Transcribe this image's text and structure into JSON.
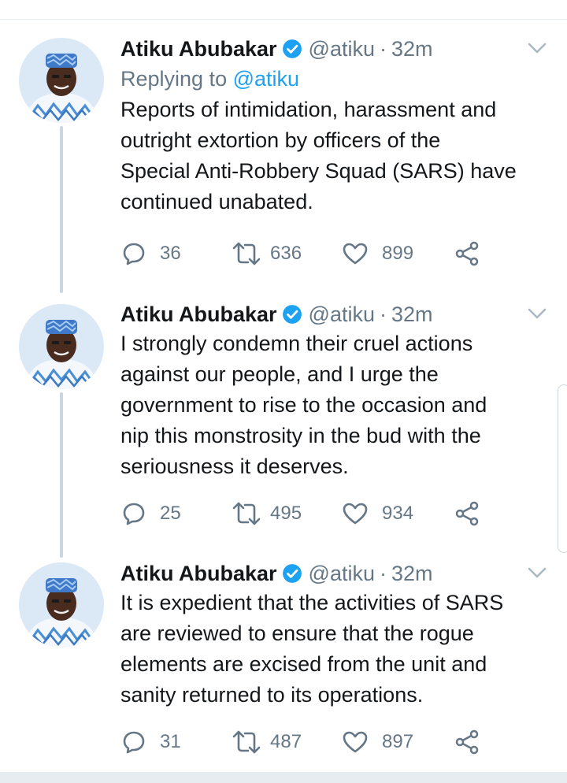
{
  "theme": {
    "accent": "#1da1f2",
    "secondary_text": "#657786",
    "thread_line": "#ccd6dd"
  },
  "tweets": [
    {
      "author_name": "Atiku Abubakar",
      "handle": "@atiku",
      "separator": "·",
      "time": "32m",
      "replying_prefix": "Replying to",
      "replying_mention": "@atiku",
      "text_lines": [
        "Reports of intimidation, harassment and",
        "outright extortion by officers of the",
        "Special Anti-Robbery Squad (SARS) have",
        "continued unabated."
      ],
      "replies": "36",
      "retweets": "636",
      "likes": "899"
    },
    {
      "author_name": "Atiku Abubakar",
      "handle": "@atiku",
      "separator": "·",
      "time": "32m",
      "text_lines": [
        "I strongly condemn their cruel actions",
        "against our people, and I urge the",
        "government to rise to the occasion and",
        "nip this monstrosity in the bud with the",
        "seriousness it deserves."
      ],
      "replies": "25",
      "retweets": "495",
      "likes": "934"
    },
    {
      "author_name": "Atiku Abubakar",
      "handle": "@atiku",
      "separator": "·",
      "time": "32m",
      "text_lines": [
        "It is expedient that the activities of SARS",
        "are reviewed to ensure that the rogue",
        "elements are excised from the unit and",
        "sanity returned to its operations."
      ],
      "replies": "31",
      "retweets": "487",
      "likes": "897"
    }
  ],
  "icons": {
    "verified": "verified-badge-icon",
    "more": "chevron-down-icon",
    "reply": "reply-bubble-icon",
    "retweet": "retweet-icon",
    "like": "heart-icon",
    "share": "share-icon"
  }
}
